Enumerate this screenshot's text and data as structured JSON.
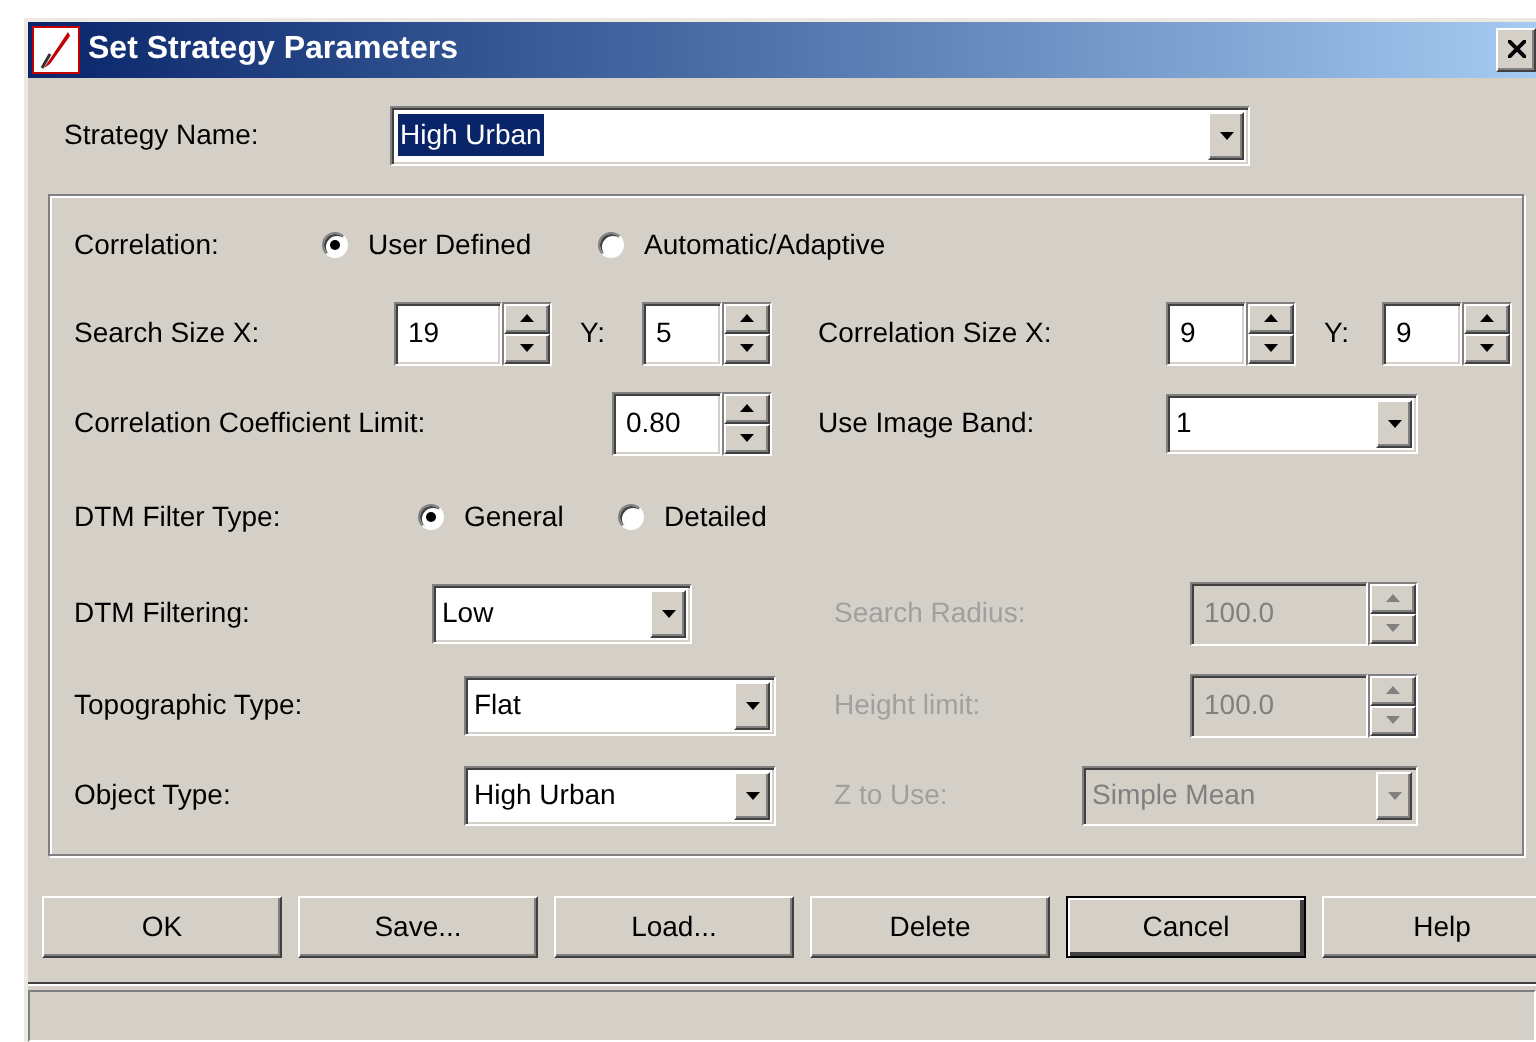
{
  "window": {
    "title": "Set Strategy Parameters"
  },
  "strategy_name": {
    "label": "Strategy Name:",
    "value": "High Urban",
    "text_selected": true
  },
  "rows": [
    {
      "fields": [
        {
          "kind": "radio",
          "label": "Correlation:",
          "options": [
            {
              "label": "User Defined",
              "selected": true
            },
            {
              "label": "Automatic/Adaptive",
              "selected": false
            }
          ]
        }
      ]
    },
    {
      "fields": [
        {
          "kind": "spin_pair",
          "label": "Search Size X:",
          "x_value": "19",
          "y_label": "Y:",
          "y_value": "5"
        },
        {
          "kind": "spin_pair",
          "label": "Correlation Size X:",
          "x_value": "9",
          "y_label": "Y:",
          "y_value": "9"
        }
      ]
    },
    {
      "fields": [
        {
          "kind": "spin",
          "label": "Correlation Coefficient Limit:",
          "value": "0.80",
          "disabled": false
        },
        {
          "kind": "dropdown",
          "label": "Use Image Band:",
          "value": "1",
          "disabled": false
        }
      ]
    },
    {
      "fields": [
        {
          "kind": "radio",
          "label": "DTM Filter Type:",
          "options": [
            {
              "label": "General",
              "selected": true
            },
            {
              "label": "Detailed",
              "selected": false
            }
          ]
        }
      ]
    },
    {
      "fields": [
        {
          "kind": "dropdown",
          "label": "DTM Filtering:",
          "value": "Low",
          "disabled": false
        },
        {
          "kind": "spin",
          "label": "Search Radius:",
          "value": "100.0",
          "disabled": true
        }
      ]
    },
    {
      "fields": [
        {
          "kind": "dropdown",
          "label": "Topographic Type:",
          "value": "Flat",
          "disabled": false
        },
        {
          "kind": "spin",
          "label": "Height limit:",
          "value": "100.0",
          "disabled": true
        }
      ]
    },
    {
      "fields": [
        {
          "kind": "dropdown",
          "label": "Object Type:",
          "value": "High Urban",
          "disabled": false
        },
        {
          "kind": "dropdown",
          "label": "Z to Use:",
          "value": "Simple Mean",
          "disabled": true
        }
      ]
    }
  ],
  "buttons": [
    {
      "label": "OK",
      "default": false
    },
    {
      "label": "Save...",
      "default": false
    },
    {
      "label": "Load...",
      "default": false
    },
    {
      "label": "Delete",
      "default": false
    },
    {
      "label": "Cancel",
      "default": true
    },
    {
      "label": "Help",
      "default": false
    }
  ]
}
